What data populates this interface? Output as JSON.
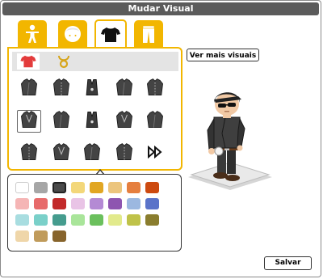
{
  "window": {
    "title": "Mudar Visual"
  },
  "tabs": [
    {
      "icon": "body-icon",
      "active": false
    },
    {
      "icon": "head-icon",
      "active": false
    },
    {
      "icon": "shirt-icon",
      "active": true
    },
    {
      "icon": "pants-icon",
      "active": false
    }
  ],
  "subtabs": [
    {
      "icon": "shirt-icon",
      "selected": true
    },
    {
      "icon": "necklace-icon",
      "selected": false
    }
  ],
  "items": [
    {
      "icon": "jacket-icon",
      "selected": false
    },
    {
      "icon": "jacket-icon",
      "selected": false
    },
    {
      "icon": "vest-icon",
      "selected": false
    },
    {
      "icon": "jacket-icon",
      "selected": false
    },
    {
      "icon": "jacket-icon",
      "selected": false
    },
    {
      "icon": "jacket-icon",
      "selected": true
    },
    {
      "icon": "jacket-icon",
      "selected": false
    },
    {
      "icon": "vest-icon",
      "selected": false
    },
    {
      "icon": "jacket-icon",
      "selected": false
    },
    {
      "icon": "jacket-icon",
      "selected": false
    },
    {
      "icon": "jacket-icon",
      "selected": false
    },
    {
      "icon": "jacket-icon",
      "selected": false
    },
    {
      "icon": "jacket-icon",
      "selected": false
    },
    {
      "icon": "jacket-icon",
      "selected": false
    },
    {
      "icon": "next-page-icon",
      "selected": false
    }
  ],
  "buttons": {
    "more_visuals": "Ver mais visuais",
    "save": "Salvar"
  },
  "palette": {
    "selected_index": 2,
    "colors": [
      "#ffffff",
      "#a6a6a6",
      "#4a4a4a",
      "#f3d77a",
      "#e1a623",
      "#ecc57d",
      "#e57f3f",
      "#cd4a10",
      "#f5b5b5",
      "#e76a6a",
      "#c22a2a",
      "#e9c4e6",
      "#b48ad4",
      "#8e55b0",
      "#9cb8e0",
      "#5a73c9",
      "#a8dde0",
      "#7ad0c9",
      "#459c8e",
      "#a9e59a",
      "#6bc05d",
      "#e2ea8c",
      "#bfc249",
      "#8a7d2e",
      "#efd6a9",
      "#c09b5b",
      "#87642c"
    ]
  },
  "avatar": {
    "description_icon": "avatar-figure-icon"
  }
}
